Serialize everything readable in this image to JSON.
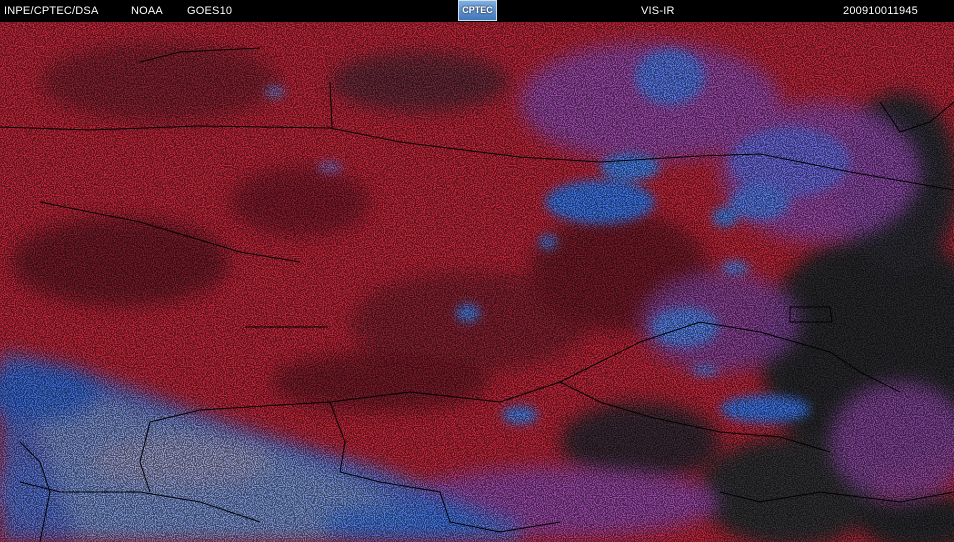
{
  "header": {
    "agency": "INPE/CPTEC/DSA",
    "provider": "NOAA",
    "satellite": "GOES10",
    "logo_text": "CPTEC",
    "channel": "VIS-IR",
    "timestamp": "200910011945"
  },
  "colors": {
    "land_red": "#c8283c",
    "cloud_blue": "#4c7de8",
    "cloud_violet": "#9a4fb8",
    "clear_dark": "#2a2a2e",
    "border_line": "#000000",
    "logo_blue": "#3f75b8"
  }
}
